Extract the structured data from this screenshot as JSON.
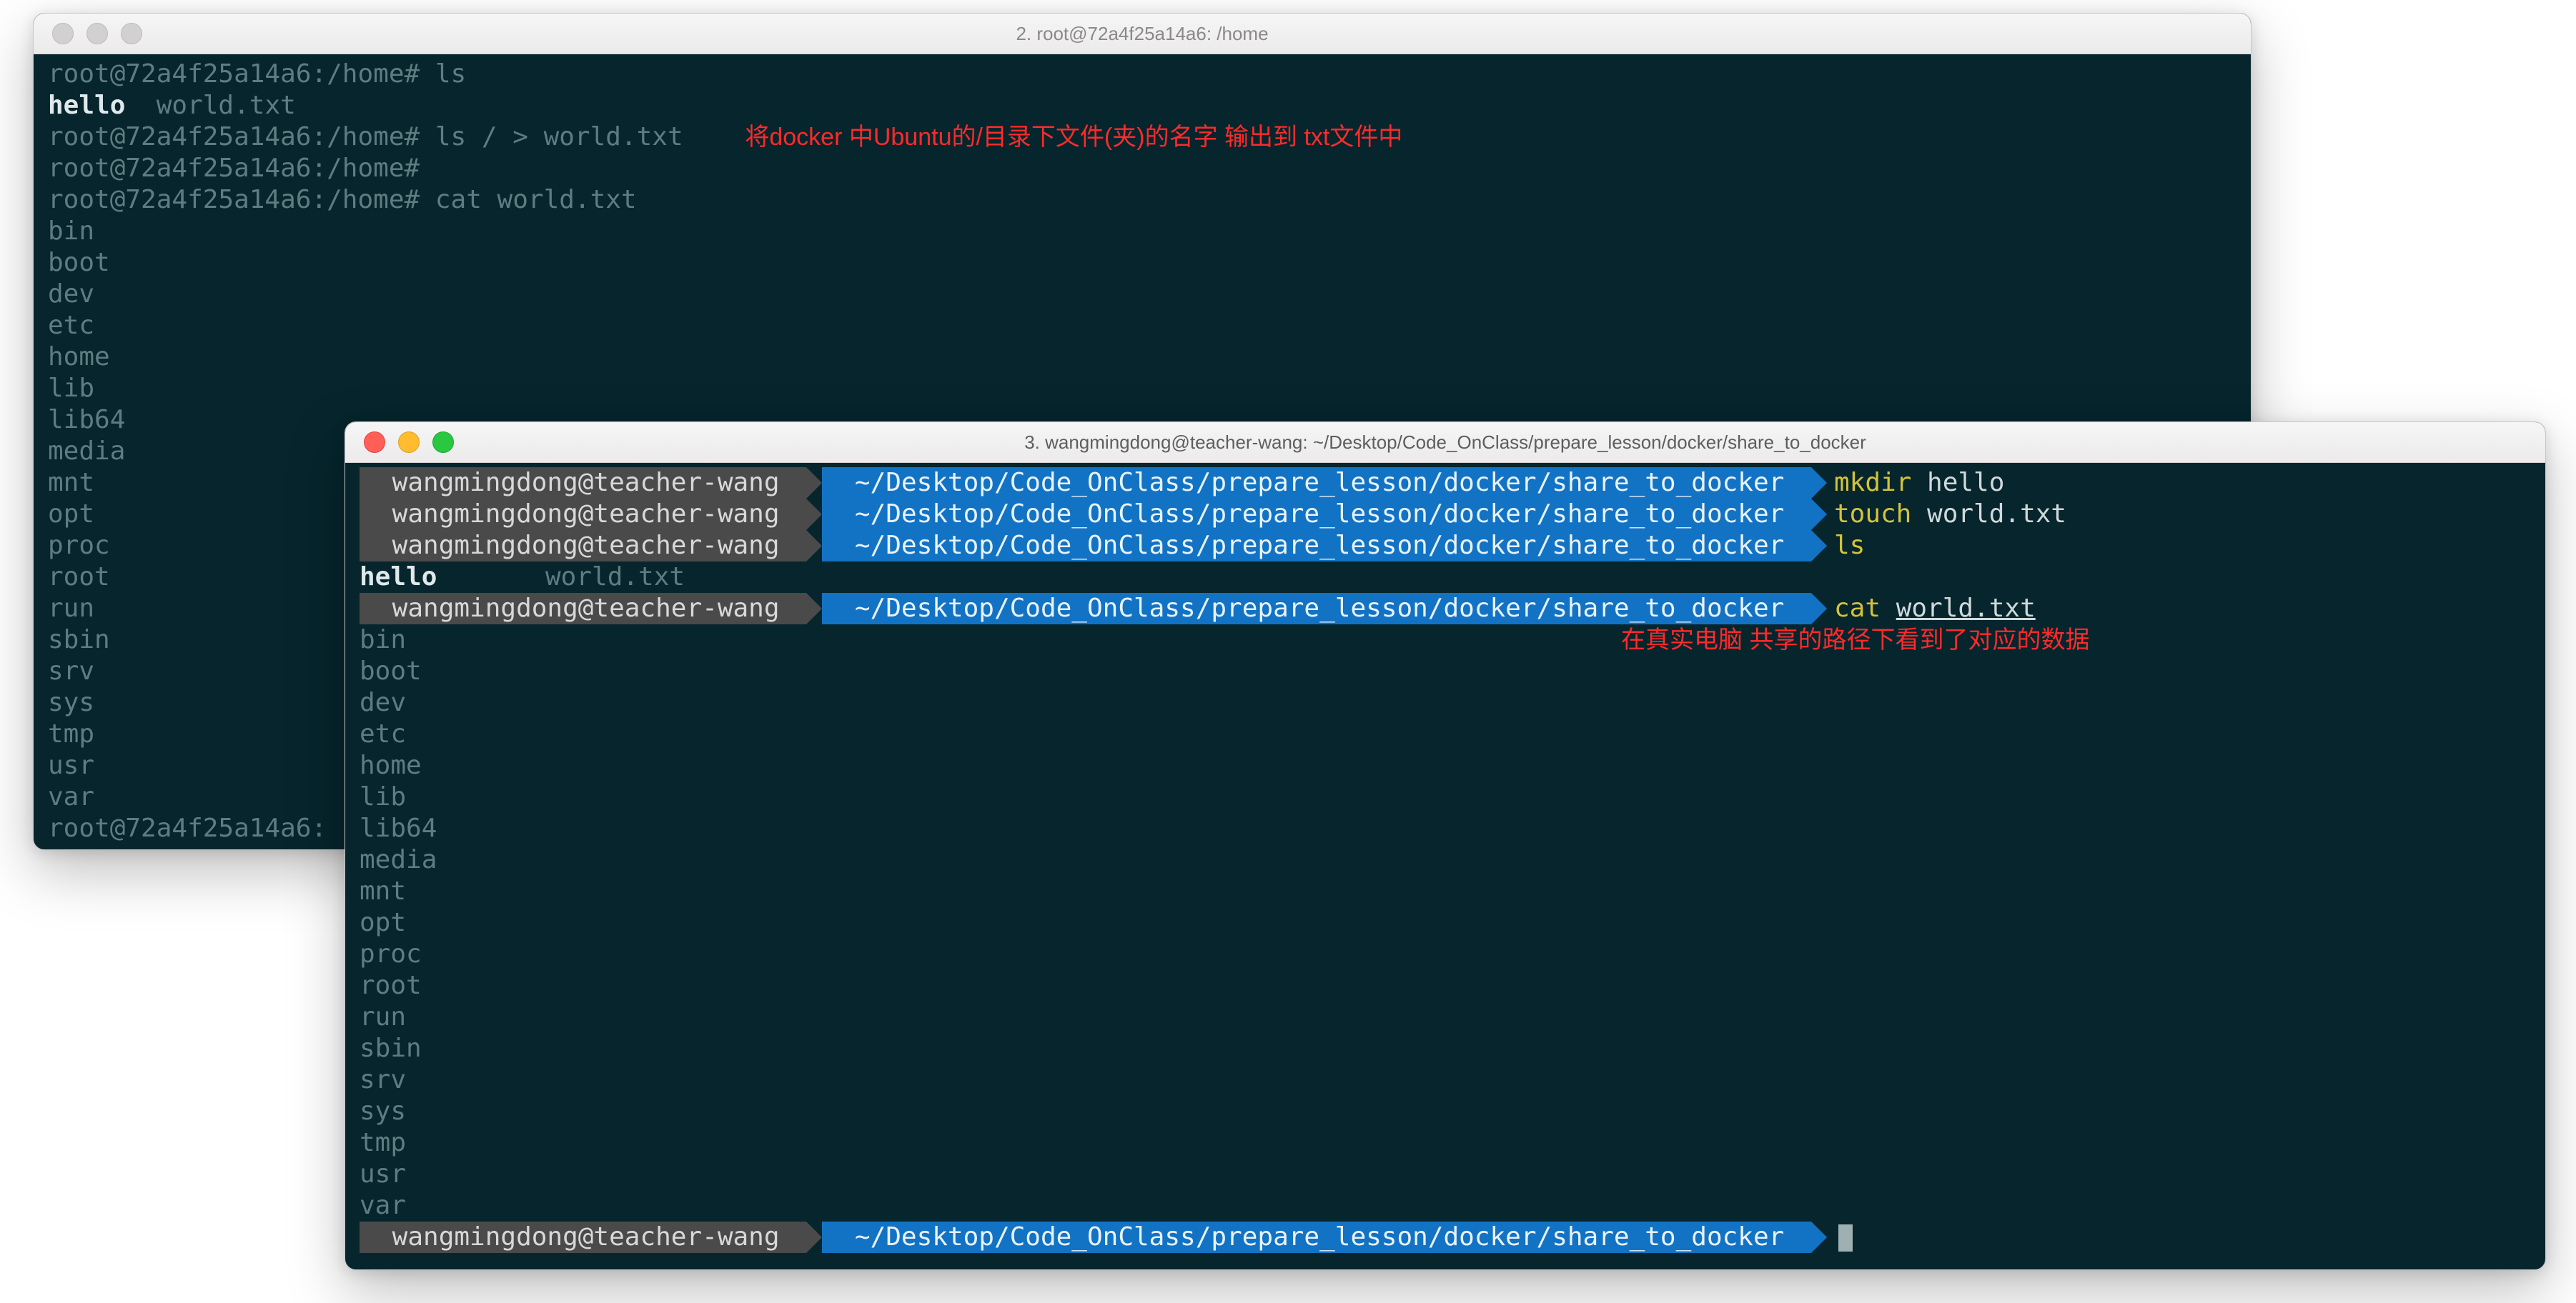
{
  "window1": {
    "title": "2. root@72a4f25a14a6: /home",
    "prompt_prefix": "root@72a4f25a14a6:/home#",
    "lines": [
      {
        "prompt": true,
        "cmd": "ls"
      },
      {
        "ls_bold": "hello",
        "ls_rest": "  world.txt"
      },
      {
        "prompt": true,
        "cmd": "ls / > world.txt",
        "annotation": "将docker 中Ubuntu的/目录下文件(夹)的名字 输出到 txt文件中"
      },
      {
        "prompt": true,
        "cmd": ""
      },
      {
        "prompt": true,
        "cmd": "cat world.txt"
      },
      {
        "plain": "bin"
      },
      {
        "plain": "boot"
      },
      {
        "plain": "dev"
      },
      {
        "plain": "etc"
      },
      {
        "plain": "home"
      },
      {
        "plain": "lib"
      },
      {
        "plain": "lib64"
      },
      {
        "plain": "media"
      },
      {
        "plain": "mnt"
      },
      {
        "plain": "opt"
      },
      {
        "plain": "proc"
      },
      {
        "plain": "root"
      },
      {
        "plain": "run"
      },
      {
        "plain": "sbin"
      },
      {
        "plain": "srv"
      },
      {
        "plain": "sys"
      },
      {
        "plain": "tmp"
      },
      {
        "plain": "usr"
      },
      {
        "plain": "var"
      },
      {
        "prompt_cut": "root@72a4f25a14a6:"
      }
    ]
  },
  "window2": {
    "title": "3. wangmingdong@teacher-wang: ~/Desktop/Code_OnClass/prepare_lesson/docker/share_to_docker",
    "host": "wangmingdong@teacher-wang",
    "path": "~/Desktop/Code_OnClass/prepare_lesson/docker/share_to_docker",
    "annotation2": "在真实电脑 共享的路径下看到了对应的数据",
    "rows": [
      {
        "type": "prompt",
        "cmd_y": "mkdir",
        "cmd_w": " hello"
      },
      {
        "type": "prompt",
        "cmd_y": "touch",
        "cmd_w": " world.txt"
      },
      {
        "type": "prompt",
        "cmd_y": "ls",
        "cmd_w": ""
      },
      {
        "type": "ls",
        "col1": "hello",
        "col2": "world.txt"
      },
      {
        "type": "prompt",
        "cmd_y": "cat",
        "cmd_w_u": "world.txt"
      },
      {
        "type": "plain",
        "t": "bin"
      },
      {
        "type": "plain",
        "t": "boot"
      },
      {
        "type": "plain",
        "t": "dev"
      },
      {
        "type": "plain",
        "t": "etc"
      },
      {
        "type": "plain",
        "t": "home"
      },
      {
        "type": "plain",
        "t": "lib"
      },
      {
        "type": "plain",
        "t": "lib64"
      },
      {
        "type": "plain",
        "t": "media"
      },
      {
        "type": "plain",
        "t": "mnt"
      },
      {
        "type": "plain",
        "t": "opt"
      },
      {
        "type": "plain",
        "t": "proc"
      },
      {
        "type": "plain",
        "t": "root"
      },
      {
        "type": "plain",
        "t": "run"
      },
      {
        "type": "plain",
        "t": "sbin"
      },
      {
        "type": "plain",
        "t": "srv"
      },
      {
        "type": "plain",
        "t": "sys"
      },
      {
        "type": "plain",
        "t": "tmp"
      },
      {
        "type": "plain",
        "t": "usr"
      },
      {
        "type": "plain",
        "t": "var"
      },
      {
        "type": "prompt_cursor"
      }
    ]
  }
}
